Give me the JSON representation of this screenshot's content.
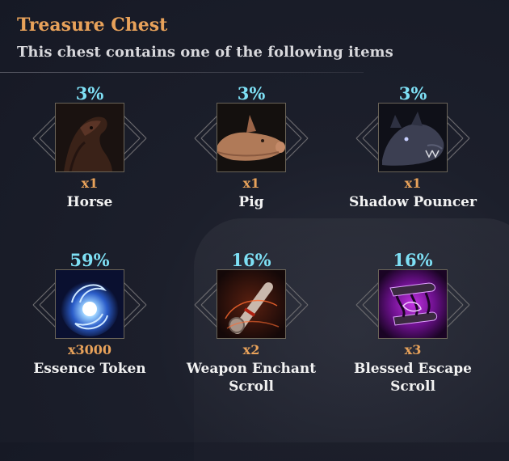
{
  "header": {
    "title": "Treasure Chest",
    "subtitle": "This chest contains one of the following items"
  },
  "items": [
    {
      "chance": "3%",
      "quantity": "x1",
      "name": "Horse",
      "icon": "horse-icon"
    },
    {
      "chance": "3%",
      "quantity": "x1",
      "name": "Pig",
      "icon": "pig-icon"
    },
    {
      "chance": "3%",
      "quantity": "x1",
      "name": "Shadow Pouncer",
      "icon": "shadow-pouncer-icon"
    },
    {
      "chance": "59%",
      "quantity": "x3000",
      "name": "Essence Token",
      "icon": "essence-token-icon"
    },
    {
      "chance": "16%",
      "quantity": "x2",
      "name": "Weapon Enchant Scroll",
      "icon": "weapon-enchant-scroll-icon"
    },
    {
      "chance": "16%",
      "quantity": "x3",
      "name": "Blessed Escape Scroll",
      "icon": "blessed-escape-scroll-icon"
    }
  ],
  "colors": {
    "title": "#e8a25a",
    "chance": "#7ee0f5",
    "quantity": "#e8a25a"
  }
}
